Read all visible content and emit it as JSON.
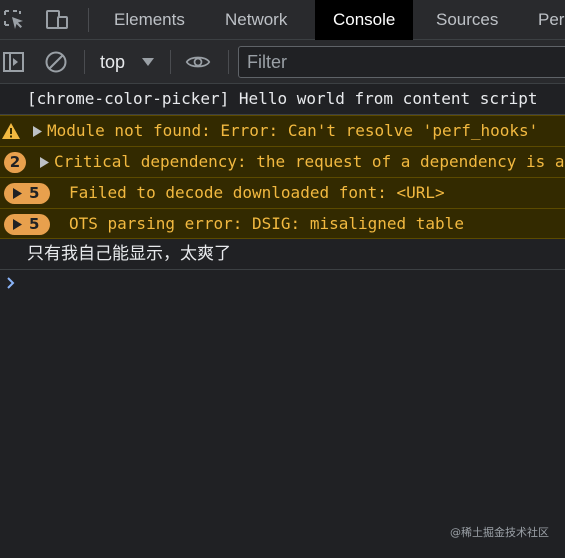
{
  "tabbar": {
    "inspect_icon": "inspect-element-icon",
    "device_icon": "device-toolbar-icon",
    "tabs": [
      {
        "label": "Elements"
      },
      {
        "label": "Network"
      },
      {
        "label": "Console"
      },
      {
        "label": "Sources"
      },
      {
        "label": "Per"
      }
    ],
    "active_tab": "Console"
  },
  "toolbar": {
    "sidebar_icon": "sidebar-toggle-icon",
    "clear_icon": "clear-console-icon",
    "context": "top",
    "eye_icon": "live-expression-icon",
    "filter_placeholder": "Filter"
  },
  "console": {
    "messages": [
      {
        "level": "log",
        "text": "[chrome-color-picker] Hello world from content script"
      },
      {
        "level": "warning",
        "text": "Module not found: Error: Can't resolve 'perf_hooks'"
      },
      {
        "level": "warning",
        "count": "2",
        "text": "Critical dependency: the request of a dependency is an expression"
      },
      {
        "level": "error",
        "count": "5",
        "text": "Failed to decode downloaded font: <URL>"
      },
      {
        "level": "error",
        "count": "5",
        "text": "OTS parsing error: DSIG: misaligned table"
      },
      {
        "level": "log",
        "text": "只有我自己能显示，太爽了"
      }
    ],
    "prompt_icon": "prompt-chevron-icon"
  },
  "watermark": "@稀土掘金技术社区",
  "colors": {
    "background": "#202124",
    "toolbar": "#292a2d",
    "active_tab": "#000000",
    "warning_bg": "#332a00",
    "warning_text": "#f2b940",
    "badge": "#e8a04d",
    "prompt": "#8ab4f8"
  }
}
